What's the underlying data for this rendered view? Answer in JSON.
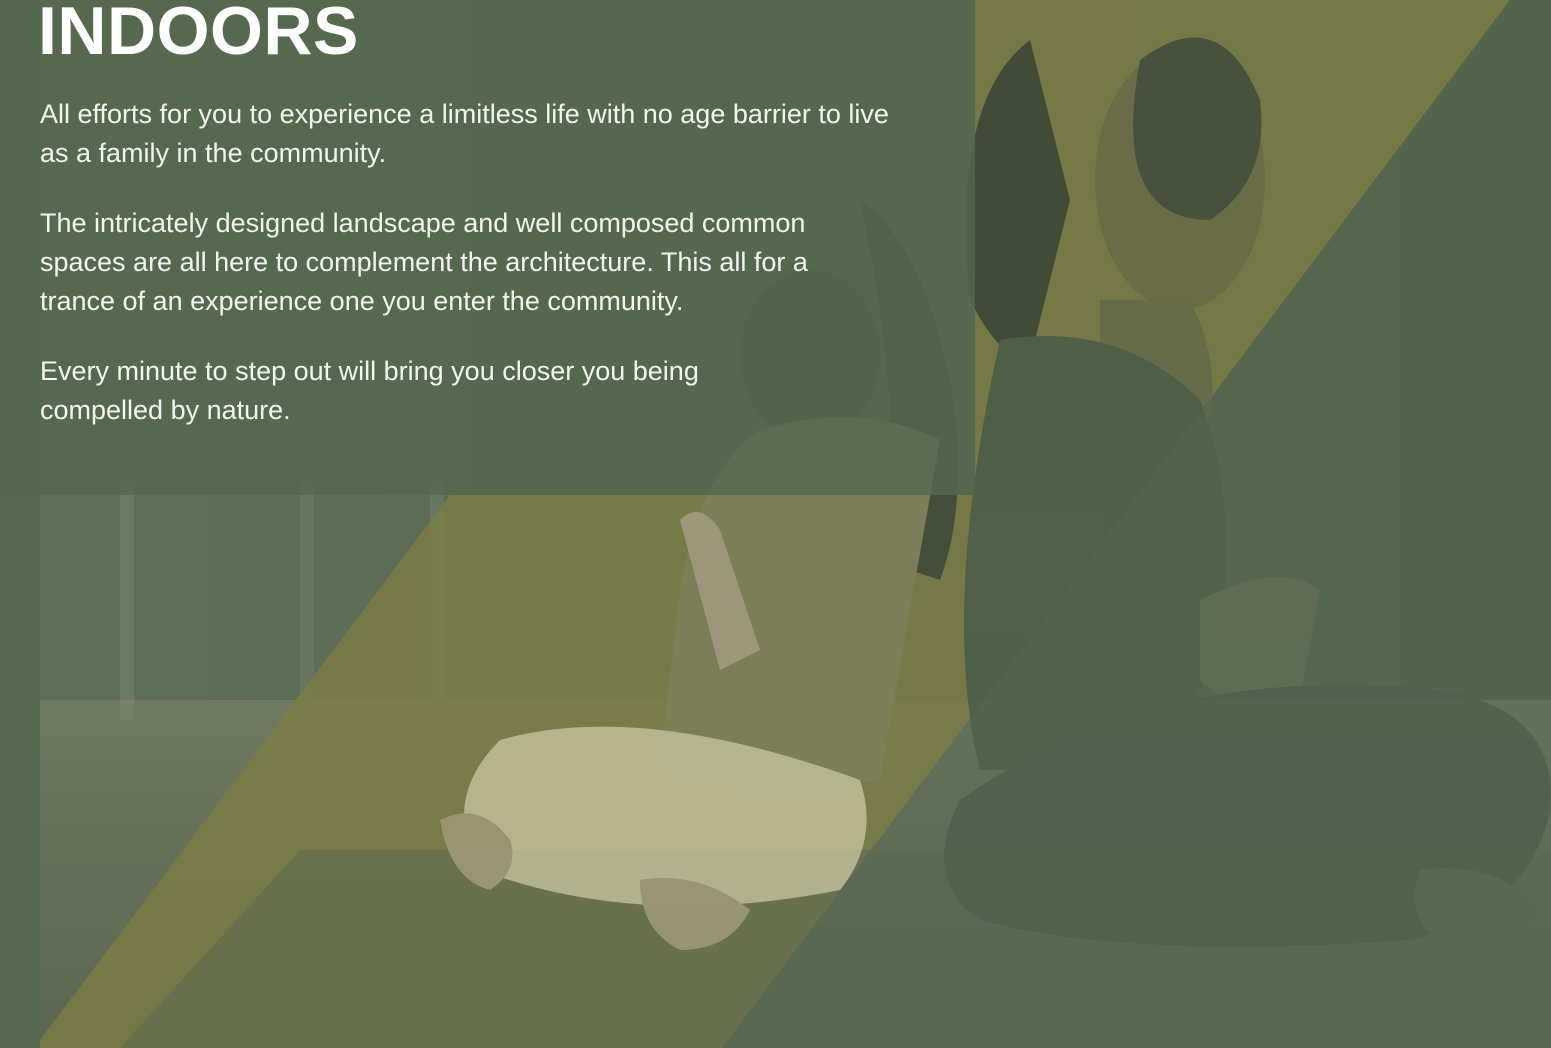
{
  "section": {
    "title": "INDOORS",
    "paragraphs": [
      "All efforts for you to experience a limitless life with no age barrier to live as a family in the community.",
      "The intricately designed landscape and well composed common spaces are all here to complement the architecture. This all for a trance of an experience one you enter the community.",
      "Every minute to step out will bring you closer you being compelled by nature."
    ]
  },
  "colors": {
    "green_overlay": "#55694f",
    "olive_band": "#7a7a45",
    "text": "#ffffff"
  }
}
